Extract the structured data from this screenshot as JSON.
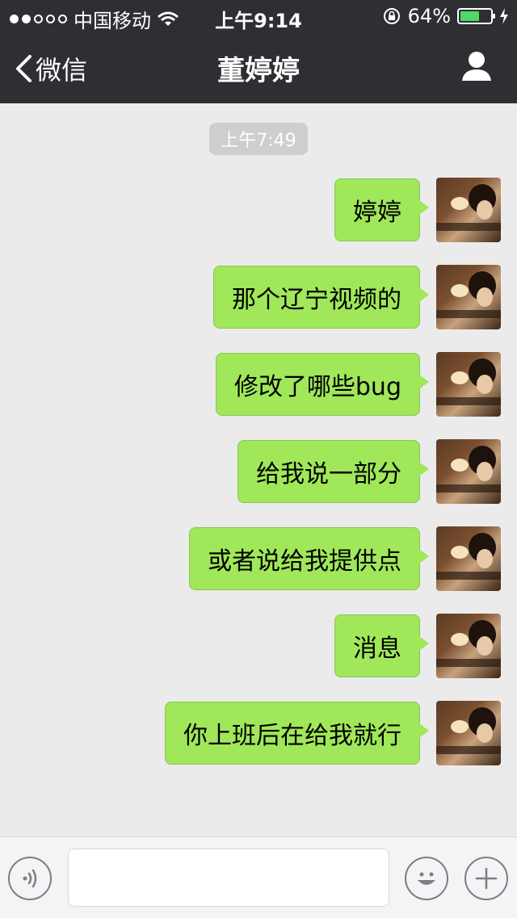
{
  "status_bar": {
    "carrier": "中国移动",
    "time": "上午9:14",
    "battery_text": "64%",
    "battery_level": 0.64,
    "icons": [
      "signal-dots-icon",
      "wifi-icon",
      "rotation-lock-icon",
      "battery-icon",
      "charging-icon"
    ]
  },
  "nav": {
    "back_label": "微信",
    "title": "董婷婷",
    "icons": [
      "chevron-left-icon",
      "profile-icon"
    ]
  },
  "chat": {
    "timestamp": "上午7:49",
    "messages": [
      {
        "text": "婷婷"
      },
      {
        "text": "那个辽宁视频的"
      },
      {
        "text": "修改了哪些bug"
      },
      {
        "text": "给我说一部分"
      },
      {
        "text": "或者说给我提供点"
      },
      {
        "text": "消息"
      },
      {
        "text": "你上班后在给我就行"
      }
    ]
  },
  "input_bar": {
    "text_value": "",
    "icons": [
      "voice-icon",
      "emoji-icon",
      "plus-icon"
    ]
  },
  "colors": {
    "nav_bg": "#2e2f33",
    "chat_bg": "#ebebeb",
    "bubble_green": "#a0e75a",
    "battery_green": "#4cd964"
  }
}
